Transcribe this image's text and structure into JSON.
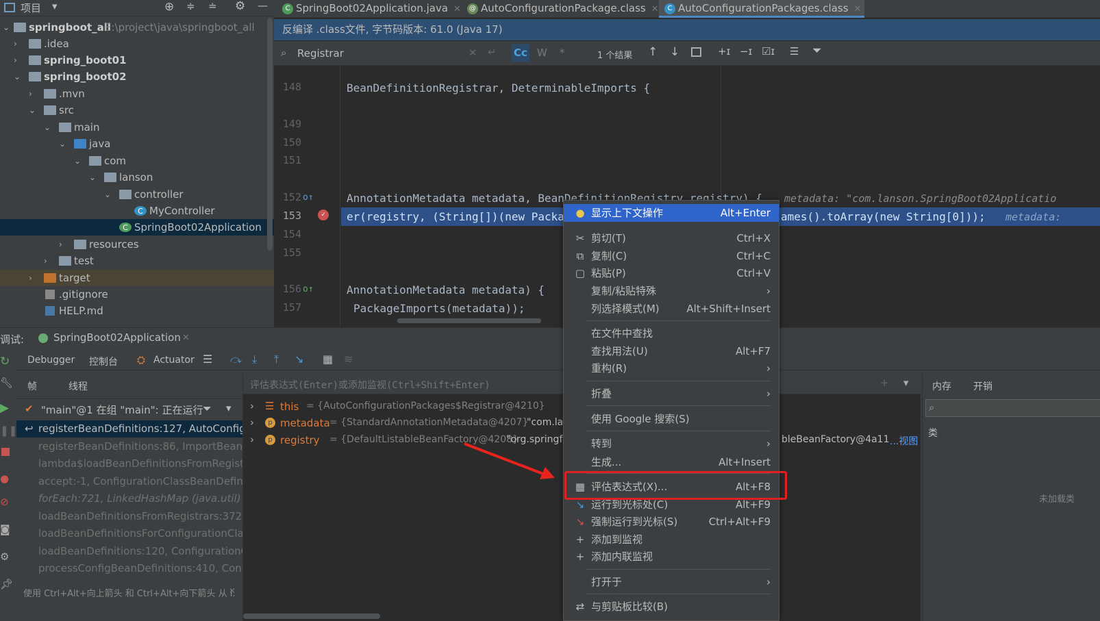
{
  "project": {
    "title": "项目",
    "root_name": "springboot_all",
    "root_path": "E:\\project\\java\\springboot_all",
    "items": [
      ".idea",
      "spring_boot01",
      "spring_boot02",
      ".mvn",
      "src",
      "main",
      "java",
      "com",
      "lanson",
      "controller",
      "MyController",
      "SpringBoot02Application",
      "resources",
      "test",
      "target",
      ".gitignore",
      "HELP.md"
    ]
  },
  "tabs": [
    "SpringBoot02Application.java",
    "AutoConfigurationPackage.class",
    "AutoConfigurationPackages.class"
  ],
  "decompile_banner": "反编译 .class文件, 字节码版本: 61.0 (Java 17)",
  "search": {
    "value": "Registrar",
    "cc": "Cc",
    "w": "W",
    "star": "*",
    "results": "1 个结果"
  },
  "editor": {
    "line_numbers": [
      "148",
      "149",
      "150",
      "151",
      "152",
      "153",
      "154",
      "155",
      "156",
      "157"
    ],
    "line148": "BeanDefinitionRegistrar, DeterminableImports {",
    "line152": "AnnotationMetadata metadata, BeanDefinitionRegistry registry) {",
    "line152_hint": "metadata: \"com.lanson.SpringBoot02Applicatio",
    "line153_a": "er(registry, (String[])(new Packa",
    "line153_b": "ames().toArray(new String[0]));",
    "line153_hint": "metadata:",
    "line156": "AnnotationMetadata metadata) {",
    "line157": "PackageImports(metadata));"
  },
  "debug": {
    "label": "调试:",
    "session": "SpringBoot02Application",
    "tabs": [
      "Debugger",
      "控制台",
      "Actuator"
    ],
    "subtabs": [
      "帧",
      "线程"
    ],
    "thread": "\"main\"@1 在组 \"main\": 正在运行",
    "frames": [
      "registerBeanDefinitions:127, AutoConfigu",
      "registerBeanDefinitions:86, ImportBeanDe",
      "lambda$loadBeanDefinitionsFromRegistra",
      "accept:-1, ConfigurationClassBeanDefinit",
      "forEach:721, LinkedHashMap (java.util)",
      "loadBeanDefinitionsFromRegistrars:372, C",
      "loadBeanDefinitionsForConfigurationClass",
      "loadBeanDefinitions:120, ConfigurationCla",
      "processConfigBeanDefinitions:410, Config"
    ],
    "hint": "使用 Ctrl+Alt+向上箭头 和 Ctrl+Alt+向下箭头 从 I.",
    "eval_placeholder": "评估表达式(Enter)或添加监视(Ctrl+Shift+Enter)",
    "vars": [
      {
        "name": "this",
        "value": "= {AutoConfigurationPackages$Registrar@4210}",
        "extra": ""
      },
      {
        "name": "metadata",
        "value": "= {StandardAnnotationMetadata@4207}",
        "extra": "\"com.la"
      },
      {
        "name": "registry",
        "value": "= {DefaultListableBeanFactory@4208}",
        "extra": "\"org.springf"
      }
    ],
    "registry_tail": "bleBeanFactory@4a11",
    "view_link": "...视图",
    "mem_tabs": [
      "内存",
      "开销"
    ],
    "class_label": "类",
    "not_loaded": "未加载类"
  },
  "menu": [
    {
      "label": "显示上下文操作",
      "shortcut": "Alt+Enter",
      "icon": "bulb-icon"
    },
    {
      "label": "剪切(T)",
      "shortcut": "Ctrl+X",
      "icon": "scissors-icon"
    },
    {
      "label": "复制(C)",
      "shortcut": "Ctrl+C",
      "icon": "copy-icon"
    },
    {
      "label": "粘贴(P)",
      "shortcut": "Ctrl+V",
      "icon": "paste-icon"
    },
    {
      "label": "复制/粘贴特殊",
      "shortcut": "›",
      "icon": ""
    },
    {
      "label": "列选择模式(M)",
      "shortcut": "Alt+Shift+Insert",
      "icon": ""
    },
    {
      "label": "在文件中查找",
      "shortcut": "",
      "icon": ""
    },
    {
      "label": "查找用法(U)",
      "shortcut": "Alt+F7",
      "icon": ""
    },
    {
      "label": "重构(R)",
      "shortcut": "›",
      "icon": ""
    },
    {
      "label": "折叠",
      "shortcut": "›",
      "icon": ""
    },
    {
      "label": "使用 Google 搜索(S)",
      "shortcut": "",
      "icon": ""
    },
    {
      "label": "转到",
      "shortcut": "›",
      "icon": ""
    },
    {
      "label": "生成...",
      "shortcut": "Alt+Insert",
      "icon": ""
    },
    {
      "label": "评估表达式(X)...",
      "shortcut": "Alt+F8",
      "icon": "calculator-icon"
    },
    {
      "label": "运行到光标处(C)",
      "shortcut": "Alt+F9",
      "icon": "run-cursor-icon"
    },
    {
      "label": "强制运行到光标(S)",
      "shortcut": "Ctrl+Alt+F9",
      "icon": "force-run-icon"
    },
    {
      "label": "添加到监视",
      "shortcut": "",
      "icon": "plus-icon"
    },
    {
      "label": "添加内联监视",
      "shortcut": "",
      "icon": "plus-icon"
    },
    {
      "label": "打开于",
      "shortcut": "›",
      "icon": ""
    },
    {
      "label": "与剪贴板比较(B)",
      "shortcut": "",
      "icon": "compare-icon"
    }
  ],
  "colors": {
    "accent": "#2f65ca",
    "highlight_box": "#e02020",
    "arrow": "#e8241c"
  }
}
